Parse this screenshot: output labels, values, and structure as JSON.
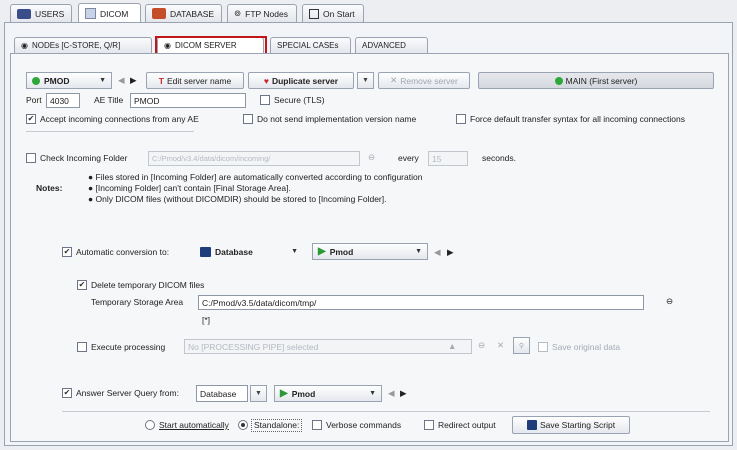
{
  "top_tabs": [
    {
      "label": "USERS",
      "icon": "users-icon"
    },
    {
      "label": "DICOM",
      "icon": "dicom-icon"
    },
    {
      "label": "DATABASE",
      "icon": "database-icon"
    },
    {
      "label": "FTP Nodes",
      "icon": "ftp-icon"
    },
    {
      "label": "On Start",
      "icon": "on-start-icon"
    }
  ],
  "sub_tabs": [
    {
      "label": "NODEs [C-STORE, Q/R]"
    },
    {
      "label": "DICOM SERVER"
    },
    {
      "label": "SPECIAL CASEs"
    },
    {
      "label": "ADVANCED"
    }
  ],
  "server": {
    "selected": "PMOD",
    "edit_label": "Edit server name",
    "duplicate_label": "Duplicate server",
    "remove_label": "Remove server",
    "main_label": "MAIN (First server)"
  },
  "port": {
    "label": "Port",
    "value": "4030",
    "ae_title_label": "AE Title",
    "ae_title_value": "PMOD",
    "secure_label": "Secure (TLS)"
  },
  "options": {
    "accept_label": "Accept incoming connections from any AE",
    "no_impl_label": "Do not send implementation version name",
    "force_label": "Force default transfer syntax for all incoming connections"
  },
  "incoming": {
    "check_label": "Check Incoming Folder",
    "path": "C:/Pmod/v3.4/data/dicom/incoming/",
    "every_label": "every",
    "every_value": "15",
    "seconds_label": "seconds."
  },
  "notes": {
    "label": "Notes:",
    "items": [
      "Files stored in [Incoming Folder] are automatically converted according to configuration",
      "[Incoming Folder] can't contain [Final Storage Area].",
      "Only DICOM files (without DICOMDIR) should be stored to [Incoming Folder]."
    ]
  },
  "auto_conversion": {
    "label": "Automatic conversion to:",
    "target": "Database",
    "db": "Pmod"
  },
  "delete_temp": {
    "label": "Delete temporary DICOM files",
    "storage_label": "Temporary Storage Area",
    "storage_value": "C:/Pmod/v3.5/data/dicom/tmp/",
    "marker": "[*]"
  },
  "execute": {
    "label": "Execute processing",
    "pipe": "No [PROCESSING PIPE] selected",
    "save_original": "Save original data"
  },
  "answer": {
    "label": "Answer Server Query from:",
    "source": "Database",
    "db": "Pmod"
  },
  "footer": {
    "start_auto": "Start automatically",
    "standalone": "Standalone:",
    "verbose": "Verbose commands",
    "redirect": "Redirect output",
    "save_script": "Save Starting Script"
  }
}
